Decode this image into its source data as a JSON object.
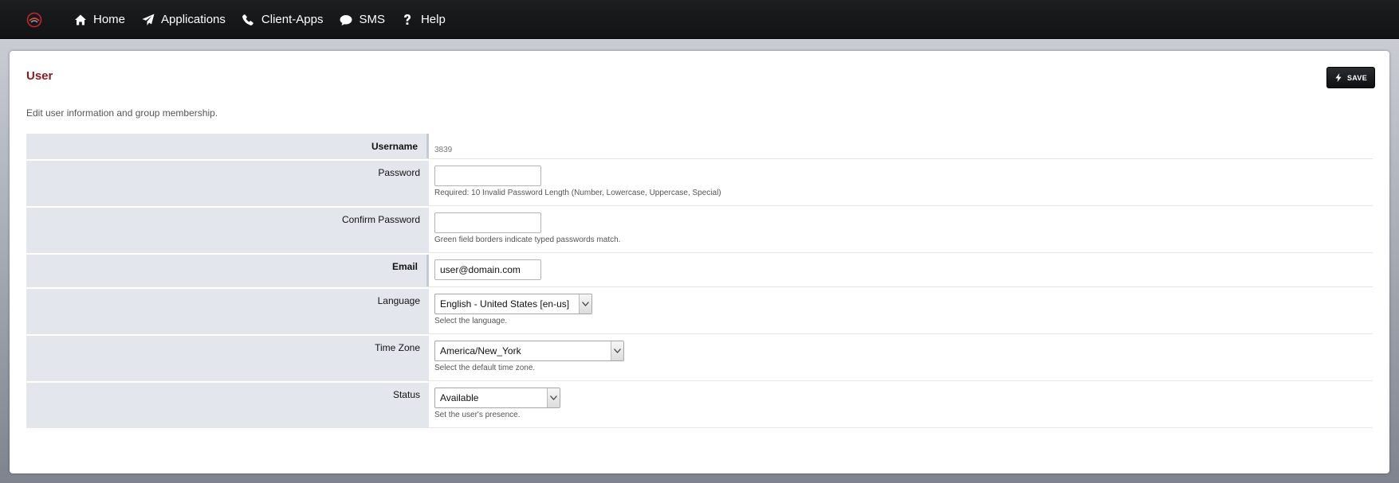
{
  "nav": {
    "items": [
      {
        "label": "Home",
        "icon": "home-icon"
      },
      {
        "label": "Applications",
        "icon": "paper-plane-icon"
      },
      {
        "label": "Client-Apps",
        "icon": "phone-icon"
      },
      {
        "label": "SMS",
        "icon": "chat-icon"
      },
      {
        "label": "Help",
        "icon": "question-icon"
      }
    ]
  },
  "page": {
    "title": "User",
    "save_label": "SAVE",
    "description": "Edit user information and group membership."
  },
  "form": {
    "username": {
      "label": "Username",
      "value": "3839"
    },
    "password": {
      "label": "Password",
      "value": "",
      "hint": "Required: 10 Invalid Password Length (Number, Lowercase, Uppercase, Special)"
    },
    "confirm_password": {
      "label": "Confirm Password",
      "value": "",
      "hint": "Green field borders indicate typed passwords match."
    },
    "email": {
      "label": "Email",
      "value": "user@domain.com"
    },
    "language": {
      "label": "Language",
      "selected": "English - United States [en-us]",
      "hint": "Select the language."
    },
    "time_zone": {
      "label": "Time Zone",
      "selected": "America/New_York",
      "hint": "Select the default time zone."
    },
    "status": {
      "label": "Status",
      "selected": "Available",
      "hint": "Set the user's presence."
    }
  },
  "colors": {
    "title": "#8a1c1c",
    "label_bg": "#e3e7ed",
    "navbar": "#141517"
  }
}
